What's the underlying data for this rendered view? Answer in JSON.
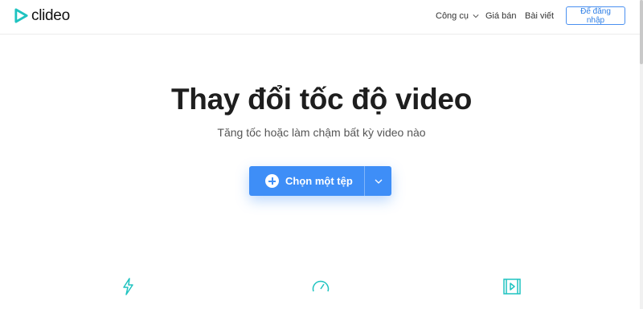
{
  "brand": {
    "name": "clideo",
    "accent": "#3e8ef7",
    "logo_color": "#1fc3c0"
  },
  "nav": {
    "tools_label": "Công cụ",
    "price_label": "Giá bán",
    "blog_label": "Bài viết",
    "login_label": "Để đăng nhập"
  },
  "hero": {
    "title": "Thay đổi tốc độ video",
    "subtitle": "Tăng tốc hoặc làm chậm bất kỳ video nào",
    "upload_label": "Chọn một tệp"
  },
  "features": [
    {
      "icon": "lightning-icon"
    },
    {
      "icon": "speedometer-icon"
    },
    {
      "icon": "video-frame-icon"
    }
  ]
}
